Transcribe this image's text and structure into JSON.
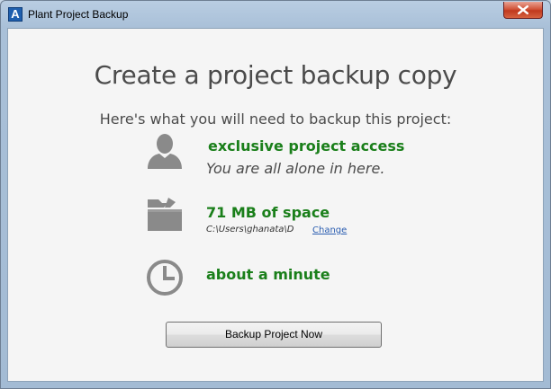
{
  "window": {
    "title": "Plant Project Backup",
    "app_icon_letter": "A"
  },
  "main": {
    "heading": "Create a project backup copy",
    "subheading": "Here's what you will need to backup this project:"
  },
  "requirements": {
    "access": {
      "icon": "user-icon",
      "title": "exclusive project access",
      "subtitle": "You are all alone in here."
    },
    "space": {
      "icon": "folder-icon",
      "title": "71 MB of space",
      "path": "C:\\Users\\ghanata\\D",
      "change_label": "Change"
    },
    "time": {
      "icon": "clock-icon",
      "title": "about a minute"
    }
  },
  "actions": {
    "backup_label": "Backup Project Now"
  },
  "colors": {
    "accent_green": "#1a7f1a",
    "icon_gray": "#8a8a8a",
    "text_gray": "#4b4b4b",
    "link_blue": "#2a5db0"
  }
}
